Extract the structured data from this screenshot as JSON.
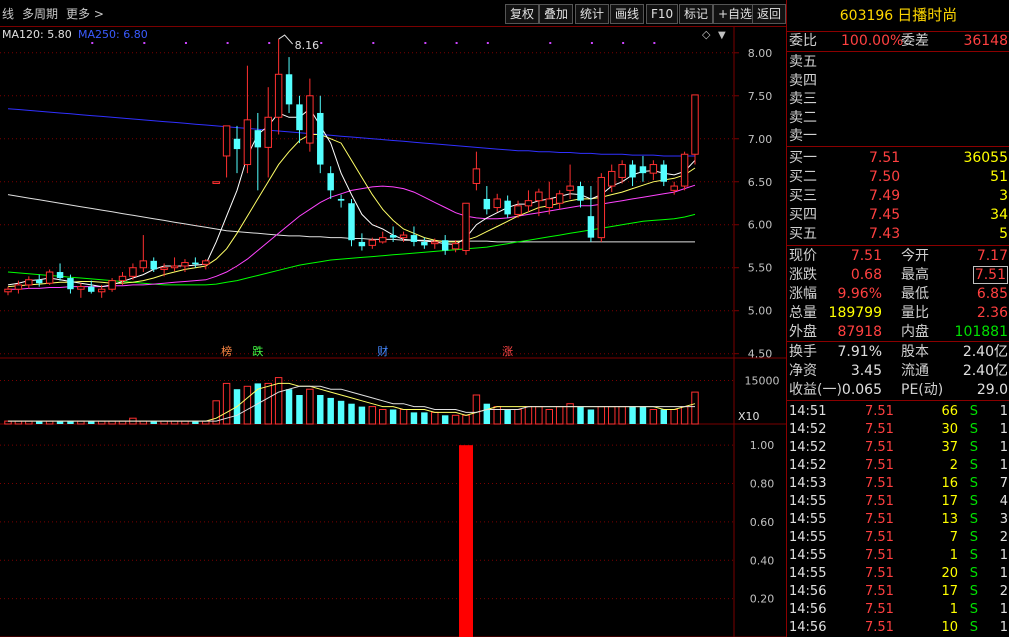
{
  "toolbar": {
    "left_items": [
      "线",
      "多周期",
      "更多 >"
    ],
    "buttons": [
      "复权",
      "叠加",
      "统计",
      "画线",
      "F10",
      "标记",
      "+自选",
      "返回"
    ]
  },
  "ma_legend": {
    "ma120": "MA120: 5.80",
    "ma250": "MA250: 6.80"
  },
  "colors": {
    "up": "#ff3030",
    "down": "#54ffff",
    "ma5": "#ffffff",
    "ma10": "#ffff66",
    "ma20": "#ff44ff",
    "ma60": "#00ff00",
    "ma120": "#e0e0e0",
    "ma250": "#3030ff",
    "grid": "#7a0000"
  },
  "chart_data": [
    {
      "type": "candlestick",
      "price_axis": {
        "ticks": [
          "8.00",
          "7.50",
          "7.00",
          "6.50",
          "6.00",
          "5.50",
          "5.00",
          "4.50"
        ],
        "ylim": [
          4.45,
          8.3
        ]
      },
      "peak_label": "8.16",
      "event_markers": [
        "榜",
        "跌",
        "财",
        "涨"
      ],
      "candles": [
        [
          5.22,
          5.28,
          5.18,
          5.25
        ],
        [
          5.25,
          5.35,
          5.2,
          5.3
        ],
        [
          5.3,
          5.4,
          5.26,
          5.36
        ],
        [
          5.36,
          5.42,
          5.28,
          5.32
        ],
        [
          5.32,
          5.48,
          5.3,
          5.45
        ],
        [
          5.45,
          5.55,
          5.35,
          5.38
        ],
        [
          5.38,
          5.42,
          5.2,
          5.25
        ],
        [
          5.25,
          5.32,
          5.15,
          5.28
        ],
        [
          5.28,
          5.35,
          5.2,
          5.22
        ],
        [
          5.22,
          5.3,
          5.15,
          5.25
        ],
        [
          5.25,
          5.38,
          5.22,
          5.35
        ],
        [
          5.35,
          5.45,
          5.3,
          5.4
        ],
        [
          5.4,
          5.55,
          5.36,
          5.5
        ],
        [
          5.5,
          5.88,
          5.45,
          5.58
        ],
        [
          5.58,
          5.62,
          5.45,
          5.48
        ],
        [
          5.48,
          5.55,
          5.4,
          5.5
        ],
        [
          5.5,
          5.62,
          5.46,
          5.52
        ],
        [
          5.52,
          5.6,
          5.45,
          5.56
        ],
        [
          5.56,
          5.62,
          5.5,
          5.54
        ],
        [
          5.54,
          5.6,
          5.48,
          5.58
        ],
        [
          6.48,
          6.5,
          6.48,
          6.5
        ],
        [
          6.8,
          7.15,
          6.55,
          7.15
        ],
        [
          7.0,
          7.15,
          6.6,
          6.88
        ],
        [
          6.7,
          7.85,
          6.6,
          7.22
        ],
        [
          7.1,
          7.3,
          6.4,
          6.9
        ],
        [
          6.9,
          7.6,
          6.55,
          7.25
        ],
        [
          7.25,
          8.16,
          7.05,
          7.75
        ],
        [
          7.75,
          7.95,
          7.3,
          7.4
        ],
        [
          7.4,
          7.5,
          6.95,
          7.1
        ],
        [
          6.95,
          7.7,
          6.85,
          7.5
        ],
        [
          7.3,
          7.5,
          6.6,
          6.7
        ],
        [
          6.6,
          6.68,
          6.3,
          6.4
        ],
        [
          6.3,
          6.35,
          6.2,
          6.28
        ],
        [
          6.25,
          6.3,
          5.75,
          5.82
        ],
        [
          5.8,
          5.9,
          5.7,
          5.75
        ],
        [
          5.76,
          5.85,
          5.72,
          5.82
        ],
        [
          5.8,
          5.92,
          5.78,
          5.85
        ],
        [
          5.88,
          5.98,
          5.8,
          5.85
        ],
        [
          5.85,
          5.92,
          5.8,
          5.88
        ],
        [
          5.88,
          5.98,
          5.75,
          5.8
        ],
        [
          5.8,
          5.85,
          5.72,
          5.76
        ],
        [
          5.78,
          5.84,
          5.72,
          5.8
        ],
        [
          5.82,
          5.88,
          5.65,
          5.7
        ],
        [
          5.72,
          5.82,
          5.68,
          5.78
        ],
        [
          5.7,
          6.25,
          5.65,
          6.25
        ],
        [
          6.48,
          6.85,
          6.4,
          6.65
        ],
        [
          6.3,
          6.45,
          6.12,
          6.18
        ],
        [
          6.2,
          6.36,
          6.15,
          6.3
        ],
        [
          6.28,
          6.34,
          6.08,
          6.12
        ],
        [
          6.12,
          6.28,
          6.08,
          6.22
        ],
        [
          6.22,
          6.4,
          6.15,
          6.28
        ],
        [
          6.28,
          6.42,
          6.1,
          6.38
        ],
        [
          6.2,
          6.5,
          6.12,
          6.3
        ],
        [
          6.25,
          6.4,
          6.18,
          6.36
        ],
        [
          6.4,
          6.7,
          6.3,
          6.45
        ],
        [
          6.45,
          6.5,
          6.2,
          6.28
        ],
        [
          6.1,
          6.45,
          5.8,
          5.85
        ],
        [
          5.85,
          6.6,
          5.8,
          6.55
        ],
        [
          6.45,
          6.7,
          6.38,
          6.62
        ],
        [
          6.55,
          6.75,
          6.48,
          6.7
        ],
        [
          6.7,
          6.75,
          6.45,
          6.55
        ],
        [
          6.68,
          6.8,
          6.5,
          6.6
        ],
        [
          6.6,
          6.75,
          6.52,
          6.7
        ],
        [
          6.7,
          6.75,
          6.45,
          6.5
        ],
        [
          6.4,
          6.5,
          6.35,
          6.45
        ],
        [
          6.45,
          6.85,
          6.4,
          6.82
        ],
        [
          6.82,
          7.51,
          6.7,
          7.51
        ]
      ],
      "ma5": [
        5.3,
        5.32,
        5.35,
        5.36,
        5.38,
        5.36,
        5.34,
        5.32,
        5.3,
        5.28,
        5.3,
        5.34,
        5.38,
        5.42,
        5.48,
        5.52,
        5.52,
        5.52,
        5.53,
        5.54,
        5.8,
        6.1,
        6.4,
        6.8,
        7.05,
        7.15,
        7.3,
        7.25,
        7.25,
        7.35,
        7.15,
        6.95,
        6.6,
        6.35,
        6.12,
        6.0,
        5.95,
        5.88,
        5.83,
        5.82,
        5.81,
        5.8,
        5.78,
        5.77,
        5.85,
        6.0,
        6.08,
        6.14,
        6.2,
        6.24,
        6.24,
        6.28,
        6.3,
        6.33,
        6.36,
        6.35,
        6.3,
        6.35,
        6.45,
        6.5,
        6.58,
        6.62,
        6.63,
        6.6,
        6.58,
        6.62,
        6.75
      ],
      "ma10": [
        5.28,
        5.29,
        5.3,
        5.31,
        5.32,
        5.33,
        5.33,
        5.34,
        5.34,
        5.33,
        5.32,
        5.32,
        5.33,
        5.35,
        5.38,
        5.42,
        5.45,
        5.48,
        5.5,
        5.52,
        5.6,
        5.72,
        5.9,
        6.1,
        6.3,
        6.5,
        6.7,
        6.85,
        6.98,
        7.05,
        7.05,
        7.0,
        6.95,
        6.75,
        6.55,
        6.35,
        6.18,
        6.05,
        5.95,
        5.9,
        5.85,
        5.82,
        5.8,
        5.8,
        5.82,
        5.86,
        5.92,
        5.98,
        6.04,
        6.1,
        6.15,
        6.2,
        6.22,
        6.25,
        6.28,
        6.3,
        6.3,
        6.32,
        6.35,
        6.38,
        6.42,
        6.46,
        6.5,
        6.52,
        6.54,
        6.58,
        6.66
      ],
      "ma20": [
        5.25,
        5.25,
        5.26,
        5.26,
        5.27,
        5.27,
        5.28,
        5.28,
        5.28,
        5.28,
        5.29,
        5.29,
        5.3,
        5.3,
        5.31,
        5.32,
        5.33,
        5.34,
        5.35,
        5.36,
        5.4,
        5.45,
        5.52,
        5.6,
        5.7,
        5.8,
        5.9,
        6.0,
        6.1,
        6.18,
        6.26,
        6.32,
        6.36,
        6.4,
        6.42,
        6.44,
        6.45,
        6.44,
        6.42,
        6.38,
        6.32,
        6.26,
        6.2,
        6.14,
        6.1,
        6.08,
        6.07,
        6.07,
        6.08,
        6.1,
        6.12,
        6.14,
        6.16,
        6.18,
        6.2,
        6.22,
        6.22,
        6.24,
        6.26,
        6.28,
        6.3,
        6.32,
        6.34,
        6.36,
        6.38,
        6.42,
        6.46
      ],
      "ma60": [
        5.45,
        5.44,
        5.43,
        5.42,
        5.41,
        5.4,
        5.39,
        5.38,
        5.37,
        5.36,
        5.35,
        5.34,
        5.33,
        5.32,
        5.31,
        5.3,
        5.3,
        5.3,
        5.3,
        5.3,
        5.31,
        5.33,
        5.35,
        5.38,
        5.41,
        5.44,
        5.47,
        5.5,
        5.53,
        5.55,
        5.57,
        5.59,
        5.6,
        5.61,
        5.62,
        5.63,
        5.64,
        5.65,
        5.66,
        5.67,
        5.68,
        5.69,
        5.7,
        5.71,
        5.72,
        5.73,
        5.74,
        5.76,
        5.78,
        5.8,
        5.82,
        5.84,
        5.86,
        5.88,
        5.9,
        5.92,
        5.94,
        5.96,
        5.98,
        6.0,
        6.02,
        6.04,
        6.05,
        6.06,
        6.07,
        6.09,
        6.12
      ],
      "ma120": [
        6.35,
        6.33,
        6.31,
        6.29,
        6.27,
        6.25,
        6.23,
        6.21,
        6.19,
        6.17,
        6.15,
        6.13,
        6.11,
        6.09,
        6.07,
        6.05,
        6.03,
        6.01,
        5.99,
        5.97,
        5.95,
        5.93,
        5.92,
        5.91,
        5.9,
        5.89,
        5.88,
        5.87,
        5.87,
        5.86,
        5.86,
        5.85,
        5.85,
        5.84,
        5.84,
        5.83,
        5.83,
        5.83,
        5.82,
        5.82,
        5.82,
        5.81,
        5.81,
        5.81,
        5.81,
        5.81,
        5.81,
        5.8,
        5.8,
        5.8,
        5.8,
        5.8,
        5.8,
        5.8,
        5.8,
        5.8,
        5.8,
        5.8,
        5.8,
        5.8,
        5.8,
        5.8,
        5.8,
        5.8,
        5.8,
        5.8,
        5.8
      ],
      "ma250": [
        7.35,
        7.34,
        7.33,
        7.32,
        7.31,
        7.3,
        7.29,
        7.28,
        7.27,
        7.26,
        7.25,
        7.24,
        7.23,
        7.22,
        7.21,
        7.2,
        7.19,
        7.18,
        7.17,
        7.16,
        7.15,
        7.14,
        7.13,
        7.12,
        7.11,
        7.1,
        7.09,
        7.08,
        7.07,
        7.06,
        7.05,
        7.04,
        7.03,
        7.02,
        7.01,
        7.0,
        6.99,
        6.98,
        6.97,
        6.96,
        6.95,
        6.94,
        6.93,
        6.92,
        6.91,
        6.9,
        6.89,
        6.88,
        6.87,
        6.86,
        6.86,
        6.85,
        6.85,
        6.84,
        6.84,
        6.83,
        6.83,
        6.82,
        6.82,
        6.82,
        6.81,
        6.81,
        6.81,
        6.8,
        6.8,
        6.8,
        6.8
      ]
    },
    {
      "type": "bar",
      "name": "volume",
      "axis_ticks": [
        "15000"
      ],
      "unit_label": "X10",
      "values": [
        1,
        1,
        1,
        1,
        1,
        1,
        1,
        1,
        1,
        1,
        1,
        1,
        2,
        1,
        1,
        1,
        1,
        1,
        1,
        1,
        8,
        14,
        12,
        13,
        14,
        14,
        16,
        12,
        10,
        12,
        10,
        9,
        8,
        7,
        6,
        6,
        5,
        5,
        5,
        4,
        4,
        4,
        3,
        3,
        3,
        10,
        7,
        6,
        5,
        5,
        6,
        6,
        5,
        6,
        7,
        6,
        5,
        6,
        6,
        6,
        6,
        6,
        5,
        5,
        5,
        6,
        11
      ],
      "ma_a": [
        1,
        1,
        1,
        1,
        1,
        1,
        1,
        1,
        1,
        1,
        1,
        1,
        1,
        1,
        1,
        1,
        1,
        1,
        1,
        1,
        2,
        4,
        6,
        9,
        12,
        13,
        14,
        14,
        13,
        13,
        12,
        11,
        10,
        9,
        8,
        7,
        6,
        6,
        5,
        5,
        5,
        4,
        4,
        4,
        3,
        4,
        5,
        6,
        6,
        6,
        6,
        6,
        6,
        6,
        6,
        6,
        6,
        6,
        6,
        6,
        6,
        6,
        6,
        5,
        5,
        6,
        7
      ],
      "ma_b": [
        1,
        1,
        1,
        1,
        1,
        1,
        1,
        1,
        1,
        1,
        1,
        1,
        1,
        1,
        1,
        1,
        1,
        1,
        1,
        1,
        1,
        2,
        3,
        5,
        7,
        9,
        11,
        12,
        13,
        13,
        13,
        12,
        12,
        11,
        10,
        9,
        8,
        7,
        7,
        6,
        6,
        5,
        5,
        5,
        4,
        4,
        5,
        5,
        5,
        5,
        6,
        6,
        6,
        6,
        6,
        6,
        6,
        6,
        6,
        6,
        6,
        6,
        6,
        6,
        6,
        6,
        6
      ]
    },
    {
      "type": "bar",
      "name": "indicator",
      "axis_ticks": [
        "1.00",
        "0.80",
        "0.60",
        "0.40",
        "0.20"
      ],
      "ylim": [
        0,
        1.1
      ],
      "bars": [
        {
          "index": 44,
          "value": 1.0
        }
      ]
    }
  ],
  "panel": {
    "code": "603196",
    "name": "日播时尚",
    "weibi_label": "委比",
    "weibi_value": "100.00%",
    "weicha_label": "委差",
    "weicha_value": "36148",
    "sell_labels": [
      "卖五",
      "卖四",
      "卖三",
      "卖二",
      "卖一"
    ],
    "buy": [
      {
        "label": "买一",
        "price": "7.51",
        "vol": "36055"
      },
      {
        "label": "买二",
        "price": "7.50",
        "vol": "51"
      },
      {
        "label": "买三",
        "price": "7.49",
        "vol": "3"
      },
      {
        "label": "买四",
        "price": "7.45",
        "vol": "34"
      },
      {
        "label": "买五",
        "price": "7.43",
        "vol": "5"
      }
    ],
    "quote": [
      {
        "l1": "现价",
        "v1": "7.51",
        "l2": "今开",
        "v2": "7.17"
      },
      {
        "l1": "涨跌",
        "v1": "0.68",
        "l2": "最高",
        "v2": "7.51"
      },
      {
        "l1": "涨幅",
        "v1": "9.96%",
        "l2": "最低",
        "v2": "6.85"
      },
      {
        "l1": "总量",
        "v1": "189799",
        "l2": "量比",
        "v2": "2.36"
      },
      {
        "l1": "外盘",
        "v1": "87918",
        "l2": "内盘",
        "v2": "101881"
      }
    ],
    "stats": [
      {
        "l1": "换手",
        "v1": "7.91%",
        "l2": "股本",
        "v2": "2.40亿"
      },
      {
        "l1": "净资",
        "v1": "3.45",
        "l2": "流通",
        "v2": "2.40亿"
      },
      {
        "l1": "收益(一)",
        "v1": "0.065",
        "l2": "PE(动)",
        "v2": "29.0"
      }
    ],
    "trades": [
      {
        "time": "14:51",
        "price": "7.51",
        "vol": "66",
        "bs": "S",
        "n": "1"
      },
      {
        "time": "14:52",
        "price": "7.51",
        "vol": "30",
        "bs": "S",
        "n": "1"
      },
      {
        "time": "14:52",
        "price": "7.51",
        "vol": "37",
        "bs": "S",
        "n": "1"
      },
      {
        "time": "14:52",
        "price": "7.51",
        "vol": "2",
        "bs": "S",
        "n": "1"
      },
      {
        "time": "14:53",
        "price": "7.51",
        "vol": "16",
        "bs": "S",
        "n": "7"
      },
      {
        "time": "14:55",
        "price": "7.51",
        "vol": "17",
        "bs": "S",
        "n": "4"
      },
      {
        "time": "14:55",
        "price": "7.51",
        "vol": "13",
        "bs": "S",
        "n": "3"
      },
      {
        "time": "14:55",
        "price": "7.51",
        "vol": "7",
        "bs": "S",
        "n": "2"
      },
      {
        "time": "14:55",
        "price": "7.51",
        "vol": "1",
        "bs": "S",
        "n": "1"
      },
      {
        "time": "14:55",
        "price": "7.51",
        "vol": "20",
        "bs": "S",
        "n": "1"
      },
      {
        "time": "14:56",
        "price": "7.51",
        "vol": "17",
        "bs": "S",
        "n": "2"
      },
      {
        "time": "14:56",
        "price": "7.51",
        "vol": "1",
        "bs": "S",
        "n": "1"
      },
      {
        "time": "14:56",
        "price": "7.51",
        "vol": "10",
        "bs": "S",
        "n": "1"
      }
    ]
  }
}
